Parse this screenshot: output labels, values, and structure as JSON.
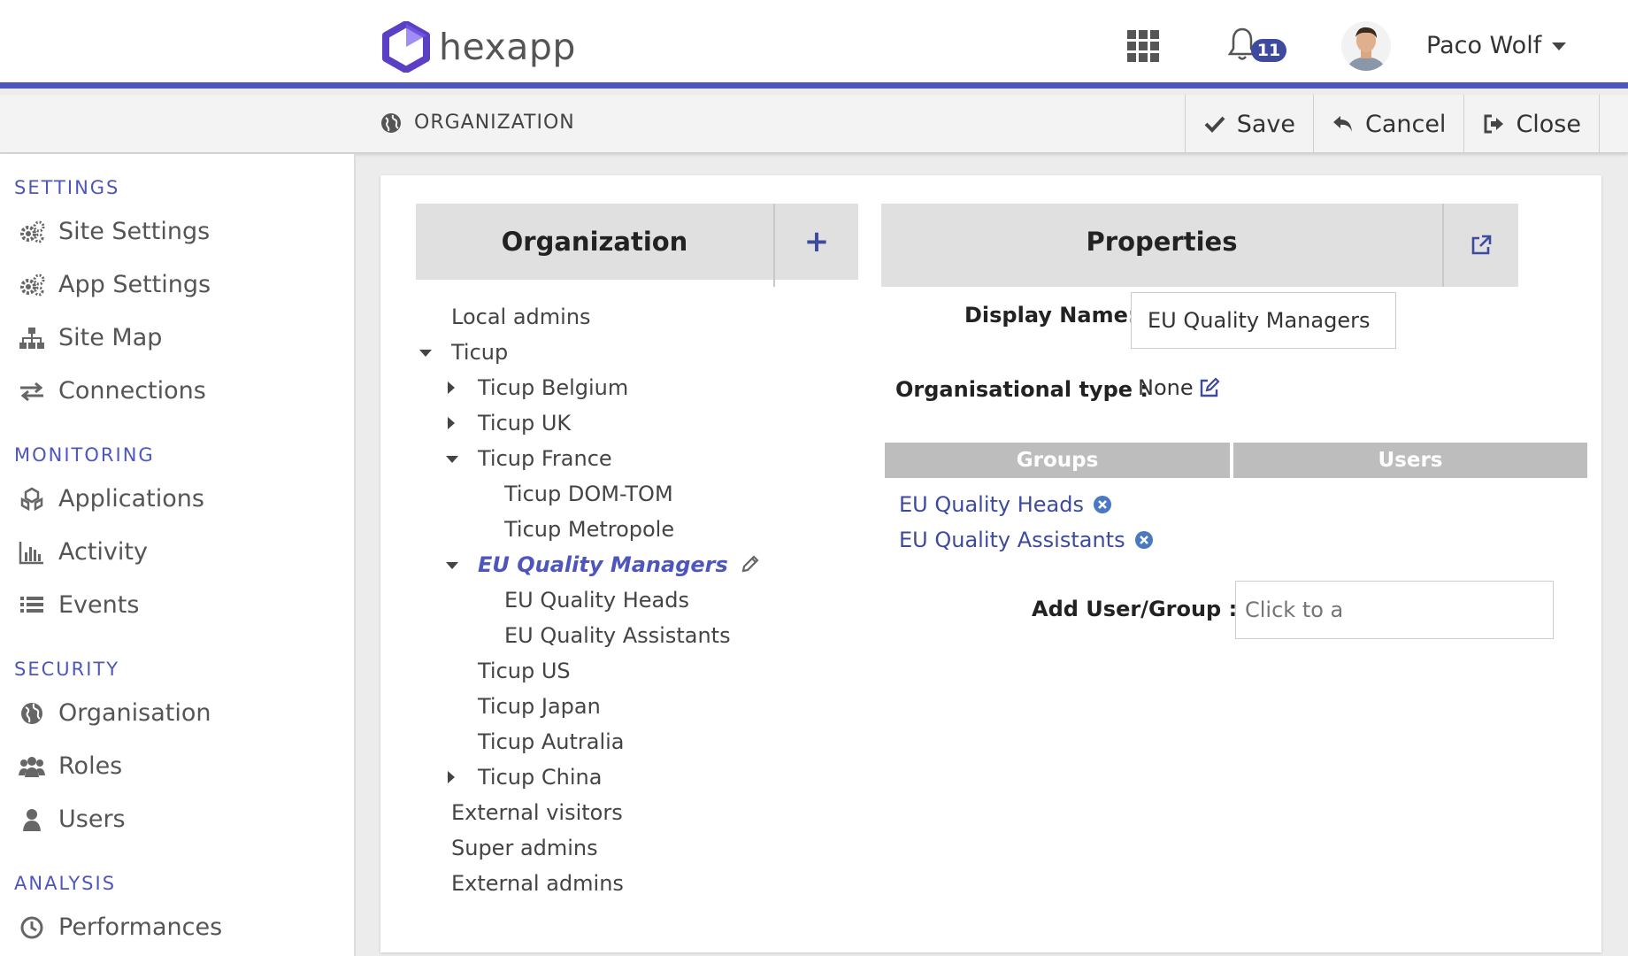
{
  "header": {
    "brand": "hexapp",
    "notifications_count": "11",
    "user_name": "Paco Wolf"
  },
  "toolbar": {
    "breadcrumb": "ORGANIZATION",
    "save_label": "Save",
    "cancel_label": "Cancel",
    "close_label": "Close"
  },
  "sidebar": {
    "sections": [
      {
        "title": "SETTINGS",
        "items": [
          {
            "label": "Site Settings",
            "icon": "gears-icon"
          },
          {
            "label": "App Settings",
            "icon": "gears-icon"
          },
          {
            "label": "Site Map",
            "icon": "sitemap-icon"
          },
          {
            "label": "Connections",
            "icon": "exchange-icon"
          }
        ]
      },
      {
        "title": "MONITORING",
        "items": [
          {
            "label": "Applications",
            "icon": "cubes-icon"
          },
          {
            "label": "Activity",
            "icon": "bar-chart-icon"
          },
          {
            "label": "Events",
            "icon": "list-icon"
          }
        ]
      },
      {
        "title": "SECURITY",
        "items": [
          {
            "label": "Organisation",
            "icon": "globe-icon"
          },
          {
            "label": "Roles",
            "icon": "users-icon"
          },
          {
            "label": "Users",
            "icon": "user-icon"
          }
        ]
      },
      {
        "title": "ANALYSIS",
        "items": [
          {
            "label": "Performances",
            "icon": "clock-icon"
          }
        ]
      }
    ]
  },
  "organization": {
    "title": "Organization",
    "add_label": "+",
    "tree": [
      {
        "label": "Local admins"
      },
      {
        "label": "Ticup"
      },
      {
        "label": "Ticup Belgium"
      },
      {
        "label": "Ticup UK"
      },
      {
        "label": "Ticup France"
      },
      {
        "label": "Ticup DOM-TOM"
      },
      {
        "label": "Ticup Metropole"
      },
      {
        "label": "EU Quality Managers"
      },
      {
        "label": "EU Quality Heads"
      },
      {
        "label": "EU Quality Assistants"
      },
      {
        "label": "Ticup US"
      },
      {
        "label": "Ticup Japan"
      },
      {
        "label": "Ticup Autralia"
      },
      {
        "label": "Ticup China"
      },
      {
        "label": "External visitors"
      },
      {
        "label": "Super admins"
      },
      {
        "label": "External admins"
      }
    ]
  },
  "properties": {
    "title": "Properties",
    "display_name_label": "Display Name:",
    "display_name_value": "EU Quality Managers",
    "org_type_label": "Organisational type :",
    "org_type_value": "None",
    "tab_groups": "Groups",
    "tab_users": "Users",
    "groups": [
      "EU Quality Heads",
      "EU Quality Assistants"
    ],
    "add_label": "Add User/Group :",
    "add_placeholder": "Click to a"
  },
  "colors": {
    "accent": "#4e56bd",
    "link": "#3e4a9e",
    "remove_icon": "#4a78c2"
  }
}
